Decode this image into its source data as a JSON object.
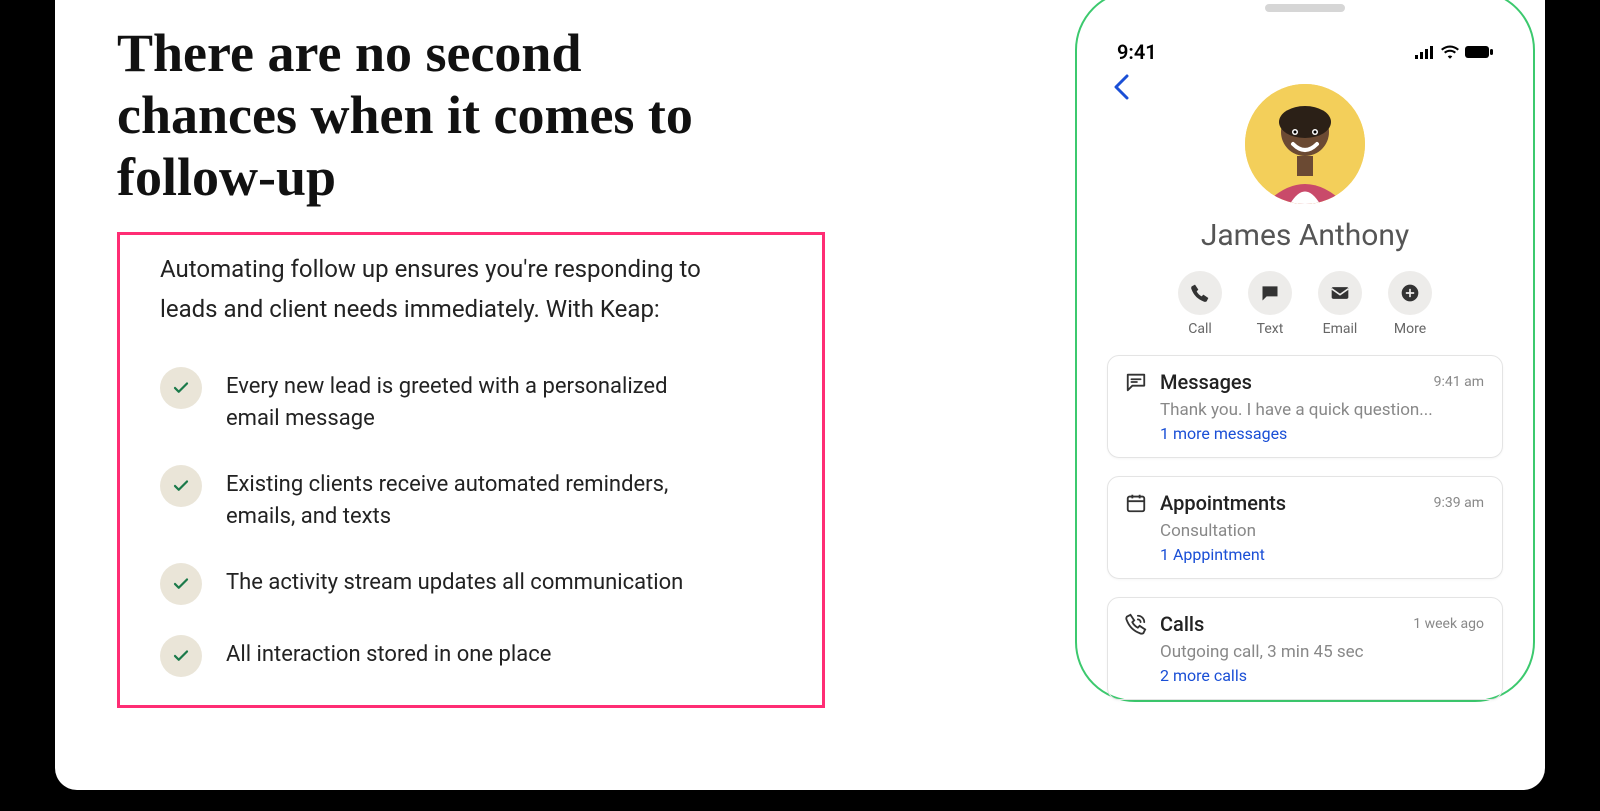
{
  "headline": "There are no second chances when it comes to follow-up",
  "intro": "Automating follow up ensures you're responding to leads and client needs immediately. With Keap:",
  "features": [
    "Every new lead is greeted with a personalized email message",
    "Existing clients receive automated reminders, emails, and texts",
    "The activity stream updates all communication",
    "All interaction stored in one place"
  ],
  "phone": {
    "time": "9:41",
    "contact_name": "James Anthony",
    "actions": {
      "call": "Call",
      "text": "Text",
      "email": "Email",
      "more": "More"
    },
    "cards": {
      "messages": {
        "title": "Messages",
        "time": "9:41 am",
        "sub": "Thank you. I have a quick question...",
        "link": "1 more messages"
      },
      "appointments": {
        "title": "Appointments",
        "time": "9:39 am",
        "sub": "Consultation",
        "link": "1 Apppintment"
      },
      "calls": {
        "title": "Calls",
        "time": "1 week ago",
        "sub": "Outgoing call, 3 min 45 sec",
        "link": "2 more calls"
      }
    }
  }
}
